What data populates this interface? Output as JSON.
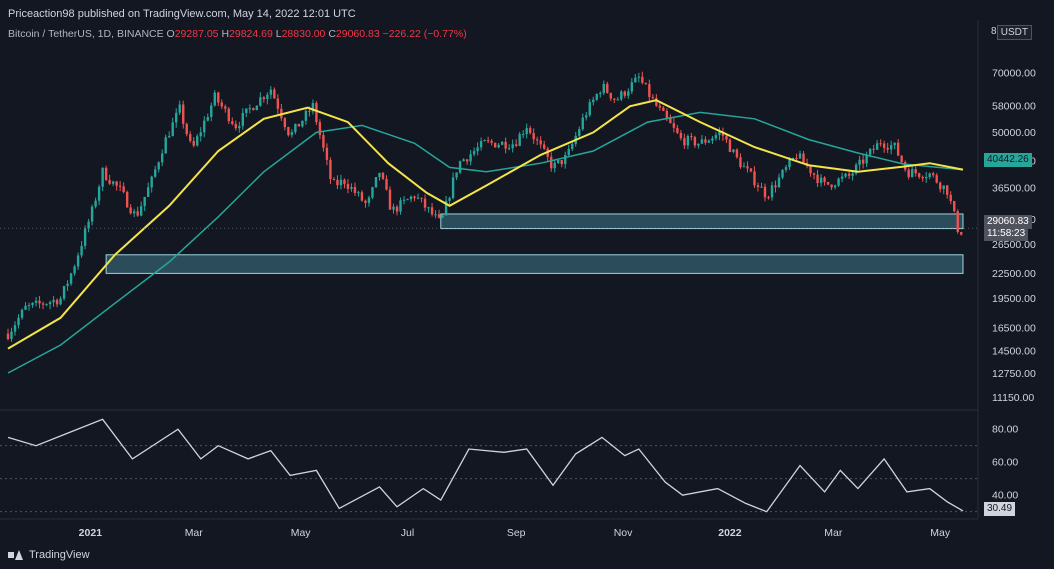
{
  "header": {
    "publisher": "Priceaction98 published on TradingView.com, May 14, 2022 12:01 UTC"
  },
  "symbol": {
    "name": "Bitcoin / TetherUS, 1D, BINANCE",
    "o_label": "O",
    "o": "29287.05",
    "h_label": "H",
    "h": "29824.69",
    "l_label": "L",
    "l": "28830.00",
    "c_label": "C",
    "c": "29060.83",
    "change": "−226.22 (−0.77%)"
  },
  "axis": {
    "currency": "USDT",
    "first_tick": "8"
  },
  "tags": {
    "ma_value": "40442.26",
    "last_price": "29060.83",
    "countdown": "11:58:23",
    "rsi_value": "30.49"
  },
  "footer": {
    "brand": "TradingView"
  },
  "colors": {
    "background": "#131722",
    "up": "#26a69a",
    "down": "#ef5350",
    "ma_fast": "#f5e34a",
    "ma_slow": "#26a69a",
    "zone": "#4a8ea0",
    "rsi": "#d1d4dc"
  },
  "chart_data": [
    {
      "type": "candlestick",
      "title": "Bitcoin / TetherUS, 1D, BINANCE",
      "y_scale": "log",
      "ylim": [
        10500,
        82000
      ],
      "price_ticks": [
        70000,
        58000,
        50000,
        42500,
        36500,
        30500,
        26500,
        22500,
        19500,
        16500,
        14500,
        12750,
        11150
      ],
      "price_tick_labels": [
        "70000.00",
        "58000.00",
        "50000.00",
        "42500.00",
        "36500.00",
        "30500.00",
        "26500.00",
        "22500.00",
        "19500.00",
        "16500.00",
        "14500.00",
        "12750.00",
        "11150.00"
      ],
      "x_labels": [
        {
          "label": "2021",
          "date": "2021-01-01"
        },
        {
          "label": "Mar",
          "date": "2021-03-01"
        },
        {
          "label": "May",
          "date": "2021-05-01"
        },
        {
          "label": "Jul",
          "date": "2021-07-01"
        },
        {
          "label": "Sep",
          "date": "2021-09-01"
        },
        {
          "label": "Nov",
          "date": "2021-11-01"
        },
        {
          "label": "2022",
          "date": "2022-01-01"
        },
        {
          "label": "Mar",
          "date": "2022-03-01"
        },
        {
          "label": "May",
          "date": "2022-05-01"
        }
      ],
      "x_range": [
        "2020-11-15",
        "2022-05-14"
      ],
      "close_points": [
        [
          "2020-11-15",
          16000
        ],
        [
          "2020-11-25",
          18500
        ],
        [
          "2020-12-05",
          19000
        ],
        [
          "2020-12-15",
          19500
        ],
        [
          "2020-12-22",
          23000
        ],
        [
          "2021-01-02",
          32000
        ],
        [
          "2021-01-08",
          40000
        ],
        [
          "2021-01-18",
          36000
        ],
        [
          "2021-01-27",
          31000
        ],
        [
          "2021-02-05",
          38000
        ],
        [
          "2021-02-12",
          47000
        ],
        [
          "2021-02-21",
          57000
        ],
        [
          "2021-02-28",
          45000
        ],
        [
          "2021-03-13",
          61000
        ],
        [
          "2021-03-25",
          52000
        ],
        [
          "2021-04-05",
          59000
        ],
        [
          "2021-04-14",
          64000
        ],
        [
          "2021-04-25",
          49000
        ],
        [
          "2021-05-08",
          58000
        ],
        [
          "2021-05-19",
          37000
        ],
        [
          "2021-05-26",
          38000
        ],
        [
          "2021-06-08",
          33000
        ],
        [
          "2021-06-15",
          40000
        ],
        [
          "2021-06-22",
          32000
        ],
        [
          "2021-07-05",
          35000
        ],
        [
          "2021-07-20",
          29800
        ],
        [
          "2021-07-30",
          42000
        ],
        [
          "2021-08-14",
          47000
        ],
        [
          "2021-08-31",
          47000
        ],
        [
          "2021-09-07",
          52000
        ],
        [
          "2021-09-22",
          41000
        ],
        [
          "2021-09-30",
          43500
        ],
        [
          "2021-10-10",
          55000
        ],
        [
          "2021-10-20",
          65000
        ],
        [
          "2021-10-28",
          60000
        ],
        [
          "2021-11-10",
          68000
        ],
        [
          "2021-11-20",
          58000
        ],
        [
          "2021-12-04",
          48000
        ],
        [
          "2021-12-15",
          47000
        ],
        [
          "2021-12-27",
          50000
        ],
        [
          "2022-01-05",
          43000
        ],
        [
          "2022-01-22",
          35000
        ],
        [
          "2022-02-08",
          44000
        ],
        [
          "2022-02-24",
          37000
        ],
        [
          "2022-03-10",
          39000
        ],
        [
          "2022-03-28",
          47500
        ],
        [
          "2022-04-05",
          46000
        ],
        [
          "2022-04-12",
          40000
        ],
        [
          "2022-04-25",
          39500
        ],
        [
          "2022-05-05",
          36000
        ],
        [
          "2022-05-12",
          28000
        ],
        [
          "2022-05-14",
          29060
        ]
      ],
      "ma_fast": [
        [
          "2020-11-15",
          14700
        ],
        [
          "2020-12-15",
          17500
        ],
        [
          "2021-01-15",
          25000
        ],
        [
          "2021-02-15",
          33000
        ],
        [
          "2021-03-15",
          45000
        ],
        [
          "2021-04-10",
          54000
        ],
        [
          "2021-05-05",
          57500
        ],
        [
          "2021-05-28",
          53000
        ],
        [
          "2021-06-20",
          42000
        ],
        [
          "2021-07-12",
          35500
        ],
        [
          "2021-07-25",
          33000
        ],
        [
          "2021-08-15",
          37000
        ],
        [
          "2021-09-15",
          44000
        ],
        [
          "2021-10-15",
          50000
        ],
        [
          "2021-11-05",
          58000
        ],
        [
          "2021-11-20",
          60000
        ],
        [
          "2021-12-15",
          53000
        ],
        [
          "2022-01-15",
          46000
        ],
        [
          "2022-02-15",
          41500
        ],
        [
          "2022-03-15",
          40000
        ],
        [
          "2022-04-10",
          41200
        ],
        [
          "2022-04-25",
          42000
        ],
        [
          "2022-05-14",
          40500
        ]
      ],
      "ma_slow": [
        [
          "2020-11-15",
          12800
        ],
        [
          "2020-12-15",
          15000
        ],
        [
          "2021-01-15",
          19000
        ],
        [
          "2021-02-15",
          24000
        ],
        [
          "2021-03-15",
          31000
        ],
        [
          "2021-04-10",
          40000
        ],
        [
          "2021-05-10",
          50000
        ],
        [
          "2021-06-05",
          52000
        ],
        [
          "2021-07-05",
          47000
        ],
        [
          "2021-07-25",
          41000
        ],
        [
          "2021-08-15",
          40000
        ],
        [
          "2021-09-15",
          42000
        ],
        [
          "2021-10-15",
          45000
        ],
        [
          "2021-11-15",
          53000
        ],
        [
          "2021-12-15",
          56000
        ],
        [
          "2022-01-15",
          54000
        ],
        [
          "2022-02-15",
          48000
        ],
        [
          "2022-03-15",
          44500
        ],
        [
          "2022-04-10",
          41800
        ],
        [
          "2022-05-14",
          40442
        ]
      ],
      "zones": [
        {
          "from": "2021-07-20",
          "to": "2022-05-14",
          "low": 29000,
          "high": 31500
        },
        {
          "from": "2021-01-10",
          "to": "2022-05-14",
          "low": 22500,
          "high": 25000
        }
      ],
      "last": 29060.83,
      "ma_label_value": 40442.26
    },
    {
      "type": "line",
      "name": "RSI",
      "ylim": [
        28,
        88
      ],
      "y_ticks": [
        80,
        60,
        40
      ],
      "y_tick_labels": [
        "80.00",
        "60.00",
        "40.00"
      ],
      "reference_lines": [
        70,
        50,
        30
      ],
      "points": [
        [
          "2020-11-15",
          75
        ],
        [
          "2020-12-01",
          70
        ],
        [
          "2020-12-20",
          78
        ],
        [
          "2021-01-08",
          86
        ],
        [
          "2021-01-25",
          62
        ],
        [
          "2021-02-20",
          80
        ],
        [
          "2021-03-05",
          62
        ],
        [
          "2021-03-15",
          70
        ],
        [
          "2021-04-01",
          62
        ],
        [
          "2021-04-14",
          67
        ],
        [
          "2021-04-25",
          52
        ],
        [
          "2021-05-10",
          55
        ],
        [
          "2021-05-23",
          32
        ],
        [
          "2021-06-15",
          45
        ],
        [
          "2021-06-25",
          33
        ],
        [
          "2021-07-10",
          44
        ],
        [
          "2021-07-20",
          37
        ],
        [
          "2021-08-05",
          68
        ],
        [
          "2021-08-25",
          66
        ],
        [
          "2021-09-07",
          68
        ],
        [
          "2021-09-22",
          46
        ],
        [
          "2021-10-05",
          65
        ],
        [
          "2021-10-20",
          75
        ],
        [
          "2021-11-02",
          64
        ],
        [
          "2021-11-10",
          68
        ],
        [
          "2021-11-25",
          48
        ],
        [
          "2021-12-05",
          40
        ],
        [
          "2021-12-25",
          44
        ],
        [
          "2022-01-10",
          35
        ],
        [
          "2022-01-22",
          30
        ],
        [
          "2022-02-10",
          58
        ],
        [
          "2022-02-24",
          42
        ],
        [
          "2022-03-05",
          55
        ],
        [
          "2022-03-15",
          44
        ],
        [
          "2022-03-30",
          62
        ],
        [
          "2022-04-12",
          42
        ],
        [
          "2022-04-25",
          44
        ],
        [
          "2022-05-05",
          36
        ],
        [
          "2022-05-14",
          30.49
        ]
      ],
      "last": 30.49
    }
  ]
}
